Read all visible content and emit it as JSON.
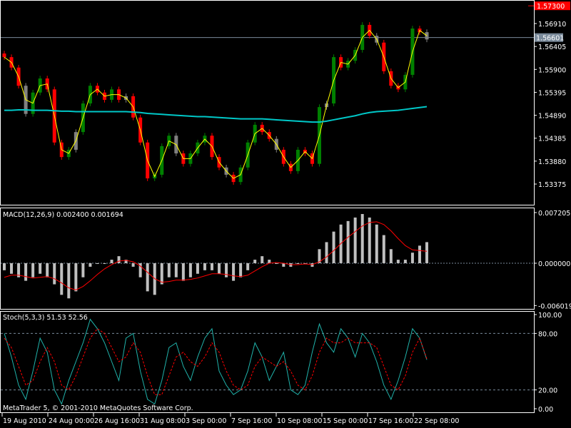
{
  "chart_data": {
    "type": "candlestick",
    "symbol_price_panel": {
      "y_ticks": [
        "1.56910",
        "1.56405",
        "1.55900",
        "1.55395",
        "1.54890",
        "1.54385",
        "1.53880",
        "1.53375"
      ],
      "ylim": [
        1.5312,
        1.5743
      ],
      "high_label": "1.57300",
      "bid_label": "1.56601",
      "bid_value": 1.56601,
      "closes": [
        1.5617,
        1.5594,
        1.5554,
        1.5492,
        1.5539,
        1.557,
        1.5546,
        1.5429,
        1.5397,
        1.5413,
        1.5452,
        1.5515,
        1.5554,
        1.5539,
        1.5523,
        1.5546,
        1.5523,
        1.5531,
        1.5484,
        1.5429,
        1.535,
        1.5358,
        1.5421,
        1.5444,
        1.5405,
        1.5382,
        1.5405,
        1.5429,
        1.5444,
        1.5397,
        1.5374,
        1.5358,
        1.5342,
        1.5374,
        1.5429,
        1.5468,
        1.5452,
        1.5437,
        1.5413,
        1.5382,
        1.5366,
        1.5413,
        1.5405,
        1.5382,
        1.5507,
        1.5515,
        1.5617,
        1.5594,
        1.5609,
        1.5633,
        1.5688,
        1.5664,
        1.5649,
        1.5586,
        1.5554,
        1.5546,
        1.5578,
        1.568,
        1.5672,
        1.5656
      ],
      "long_ma": [
        1.55,
        1.55,
        1.5501,
        1.5501,
        1.55,
        1.55,
        1.55,
        1.5499,
        1.5498,
        1.5498,
        1.5497,
        1.5497,
        1.5497,
        1.5497,
        1.5497,
        1.5497,
        1.5497,
        1.5497,
        1.5496,
        1.5495,
        1.5493,
        1.5492,
        1.5491,
        1.549,
        1.5489,
        1.5488,
        1.5487,
        1.5486,
        1.5486,
        1.5485,
        1.5484,
        1.5483,
        1.5482,
        1.5481,
        1.5481,
        1.5481,
        1.5481,
        1.548,
        1.5479,
        1.5478,
        1.5477,
        1.5476,
        1.5475,
        1.5474,
        1.5474,
        1.5476,
        1.5479,
        1.5482,
        1.5485,
        1.5488,
        1.5492,
        1.5495,
        1.5497,
        1.5498,
        1.5499,
        1.55,
        1.5502,
        1.5504,
        1.5506,
        1.5508
      ]
    },
    "macd_panel": {
      "label": "MACD(12,26,9) 0.002400 0.001694",
      "y_ticks": [
        "0.007205",
        "0.000000",
        "-0.006019"
      ],
      "ylim": [
        -0.006019,
        0.007205
      ],
      "histogram": [
        -0.001,
        -0.0015,
        -0.002,
        -0.0025,
        -0.002,
        -0.0015,
        -0.002,
        -0.003,
        -0.0045,
        -0.005,
        -0.004,
        -0.002,
        -0.0005,
        0,
        0,
        0.0005,
        0.001,
        0.0005,
        -0.0005,
        -0.002,
        -0.004,
        -0.0045,
        -0.003,
        -0.002,
        -0.002,
        -0.0025,
        -0.002,
        -0.0015,
        -0.001,
        -0.001,
        -0.0015,
        -0.002,
        -0.0025,
        -0.002,
        -0.001,
        0.0005,
        0.001,
        0.0005,
        0,
        -0.0005,
        -0.0005,
        0,
        0,
        -0.0005,
        0.002,
        0.003,
        0.0045,
        0.0055,
        0.006,
        0.0065,
        0.007,
        0.0065,
        0.0055,
        0.004,
        0.002,
        0.0005,
        0.0005,
        0.0015,
        0.0025,
        0.003
      ],
      "signal": [
        -0.002,
        -0.0017,
        -0.0017,
        -0.0019,
        -0.0021,
        -0.002,
        -0.0019,
        -0.0022,
        -0.0028,
        -0.0035,
        -0.0038,
        -0.0033,
        -0.0025,
        -0.0016,
        -0.0008,
        -0.0002,
        0.0003,
        0.0004,
        0.0002,
        -0.0004,
        -0.0013,
        -0.0022,
        -0.0027,
        -0.0026,
        -0.0024,
        -0.0024,
        -0.0023,
        -0.0021,
        -0.0018,
        -0.0015,
        -0.0015,
        -0.0016,
        -0.0018,
        -0.0019,
        -0.0017,
        -0.0011,
        -0.0005,
        0,
        0.0001,
        0,
        -0.0002,
        -0.0002,
        -0.0001,
        -0.0002,
        0.0002,
        0.0009,
        0.0018,
        0.0028,
        0.0037,
        0.0045,
        0.0053,
        0.0058,
        0.0059,
        0.0055,
        0.0046,
        0.0035,
        0.0025,
        0.0019,
        0.0018,
        0.0017
      ]
    },
    "stoch_panel": {
      "label": "Stoch(5,3,3) 51.53 52.56",
      "y_ticks": [
        "100.00",
        "80.00",
        "20.00",
        "0.00"
      ],
      "ylim": [
        0,
        100
      ],
      "levels": [
        20,
        80
      ],
      "main": [
        80,
        55,
        25,
        10,
        40,
        75,
        60,
        20,
        5,
        30,
        50,
        70,
        95,
        85,
        70,
        50,
        30,
        75,
        80,
        40,
        10,
        5,
        30,
        65,
        70,
        45,
        30,
        55,
        75,
        85,
        40,
        25,
        15,
        20,
        40,
        70,
        55,
        30,
        45,
        60,
        20,
        15,
        25,
        60,
        90,
        70,
        60,
        85,
        75,
        55,
        80,
        70,
        50,
        25,
        10,
        30,
        55,
        85,
        75,
        52
      ],
      "signal": [
        75,
        65,
        45,
        25,
        30,
        50,
        65,
        50,
        25,
        20,
        35,
        55,
        75,
        85,
        80,
        65,
        50,
        55,
        70,
        60,
        35,
        15,
        15,
        35,
        55,
        60,
        50,
        45,
        55,
        70,
        60,
        40,
        25,
        20,
        25,
        45,
        55,
        50,
        45,
        50,
        40,
        25,
        20,
        35,
        60,
        75,
        70,
        70,
        75,
        70,
        70,
        70,
        65,
        45,
        25,
        20,
        35,
        60,
        75,
        53
      ]
    },
    "time_labels": [
      "19 Aug 2010",
      "24 Aug 00:00",
      "26 Aug 16:00",
      "31 Aug 08:00",
      "3 Sep 00:00",
      "7 Sep 16:00",
      "10 Sep 08:00",
      "15 Sep 00:00",
      "17 Sep 16:00",
      "22 Sep 08:00"
    ],
    "copyright": "MetaTrader 5, © 2001-2010 MetaQuotes Software Corp.",
    "colors": {
      "up": "#008000",
      "down": "#ff0000",
      "neutral": "#808080",
      "ma_fast": "#ffff00",
      "ma_slow": "#00c8c8",
      "macd_signal": "#ff0000",
      "stoch_main": "#20b2aa",
      "stoch_signal": "#ff0000"
    }
  }
}
